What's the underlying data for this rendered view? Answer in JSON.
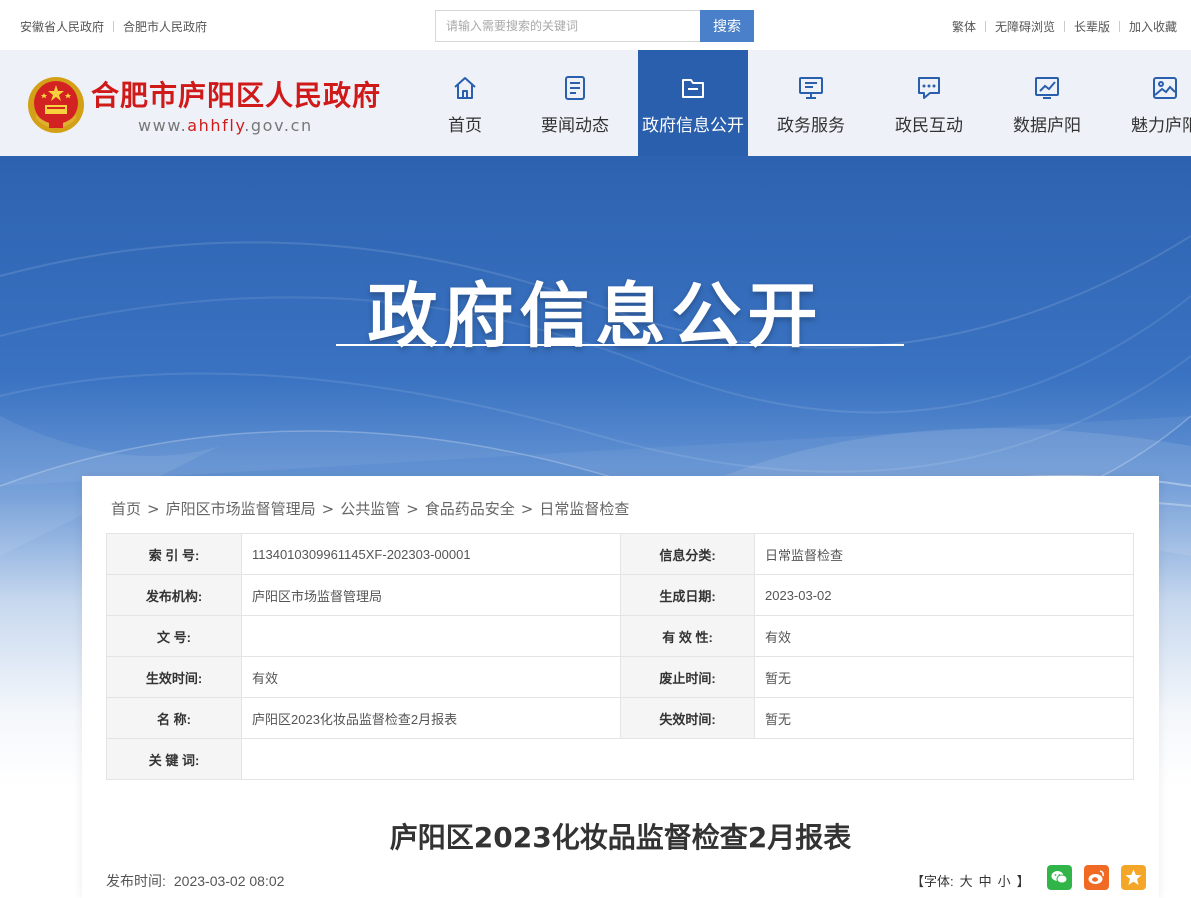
{
  "topbar": {
    "left_links": [
      "安徽省人民政府",
      "合肥市人民政府"
    ],
    "search_placeholder": "请输入需要搜索的关键词",
    "search_button": "搜索",
    "right_links": [
      "繁体",
      "无障碍浏览",
      "长辈版",
      "加入收藏"
    ]
  },
  "header": {
    "site_title": "合肥市庐阳区人民政府",
    "site_url_prefix": "www.",
    "site_url_domain": "ahhfly",
    "site_url_suffix": ".gov.cn",
    "nav": [
      {
        "label": "首页",
        "icon": "home-icon"
      },
      {
        "label": "要闻动态",
        "icon": "document-icon"
      },
      {
        "label": "政府信息公开",
        "icon": "folder-icon",
        "active": true
      },
      {
        "label": "政务服务",
        "icon": "monitor-icon"
      },
      {
        "label": "政民互动",
        "icon": "chat-icon"
      },
      {
        "label": "数据庐阳",
        "icon": "chart-icon"
      },
      {
        "label": "魅力庐阳",
        "icon": "picture-icon"
      }
    ]
  },
  "banner": {
    "title": "政府信息公开"
  },
  "breadcrumb": [
    "首页",
    "庐阳区市场监督管理局",
    "公共监管",
    "食品药品安全",
    "日常监督检查"
  ],
  "meta": {
    "rows": [
      {
        "k1": "索 引 号:",
        "v1": "1134010309961145XF-202303-00001",
        "k2": "信息分类:",
        "v2": "日常监督检查"
      },
      {
        "k1": "发布机构:",
        "v1": "庐阳区市场监督管理局",
        "k2": "生成日期:",
        "v2": "2023-03-02"
      },
      {
        "k1": "文 号:",
        "v1": "",
        "k2": "有 效 性:",
        "v2": "有效"
      },
      {
        "k1": "生效时间:",
        "v1": "有效",
        "k2": "废止时间:",
        "v2": "暂无"
      },
      {
        "k1": "名 称:",
        "v1": "庐阳区2023化妆品监督检查2月报表",
        "k2": "失效时间:",
        "v2": "暂无"
      }
    ],
    "keywords_label": "关 键 词:",
    "keywords_value": ""
  },
  "article": {
    "title": "庐阳区2023化妆品监督检查2月报表",
    "pub_label": "发布时间:",
    "pub_time": "2023-03-02 08:02",
    "font_label_open": "【字体:",
    "font_large": "大",
    "font_medium": "中",
    "font_small": "小",
    "font_label_close": "】"
  },
  "share": [
    "wechat-icon",
    "weibo-icon",
    "favorite-icon"
  ],
  "colors": {
    "brand_red": "#d01a1a",
    "nav_active": "#2a5fad",
    "search_button": "#4a7fc9"
  }
}
